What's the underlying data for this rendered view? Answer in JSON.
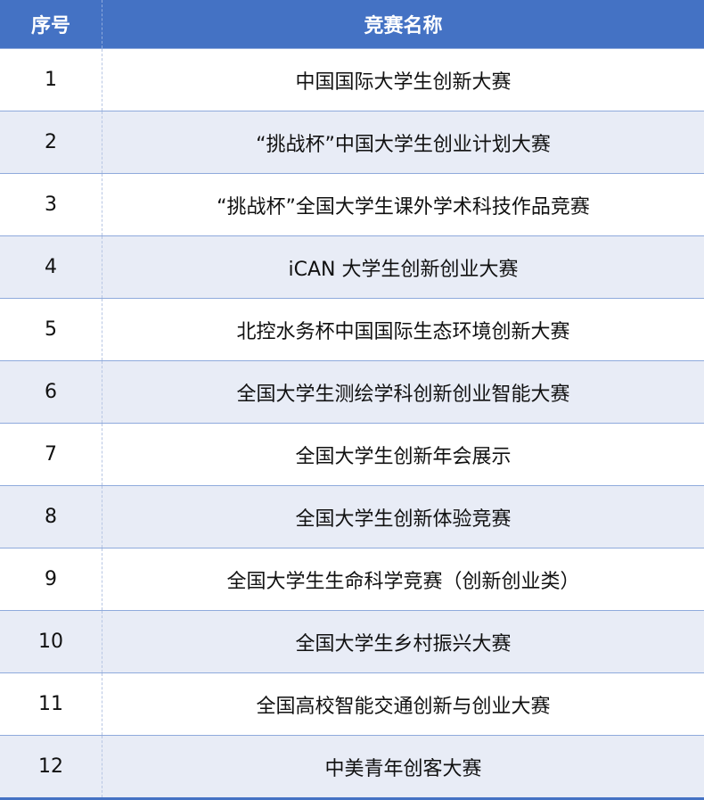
{
  "table": {
    "headers": {
      "index": "序号",
      "name": "竞赛名称"
    },
    "rows": [
      {
        "index": "1",
        "name": "中国国际大学生创新大赛"
      },
      {
        "index": "2",
        "name": "“挑战杯”中国大学生创业计划大赛"
      },
      {
        "index": "3",
        "name": "“挑战杯”全国大学生课外学术科技作品竞赛"
      },
      {
        "index": "4",
        "name": "iCAN 大学生创新创业大赛"
      },
      {
        "index": "5",
        "name": "北控水务杯中国国际生态环境创新大赛"
      },
      {
        "index": "6",
        "name": "全国大学生测绘学科创新创业智能大赛"
      },
      {
        "index": "7",
        "name": "全国大学生创新年会展示"
      },
      {
        "index": "8",
        "name": "全国大学生创新体验竞赛"
      },
      {
        "index": "9",
        "name": "全国大学生生命科学竞赛（创新创业类）"
      },
      {
        "index": "10",
        "name": "全国大学生乡村振兴大赛"
      },
      {
        "index": "11",
        "name": "全国高校智能交通创新与创业大赛"
      },
      {
        "index": "12",
        "name": "中美青年创客大赛"
      }
    ]
  },
  "colors": {
    "header_bg": "#4472c4",
    "header_text": "#ffffff",
    "alt_row_bg": "#e8ecf6",
    "row_border": "#8faadc"
  }
}
